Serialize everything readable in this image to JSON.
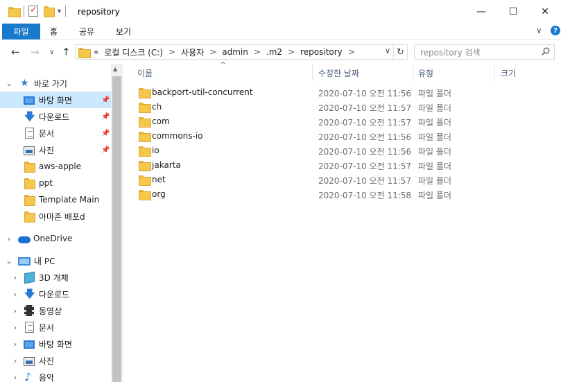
{
  "window": {
    "title": "repository",
    "minimize_glyph": "—",
    "maximize_glyph": "☐",
    "close_glyph": "✕"
  },
  "ribbon": {
    "tabs": [
      "파일",
      "홈",
      "공유",
      "보기"
    ],
    "expand_glyph": "∨",
    "help_glyph": "?"
  },
  "nav": {
    "back_glyph": "←",
    "forward_glyph": "→",
    "recent_glyph": "∨",
    "up_glyph": "↑"
  },
  "address": {
    "overflow": "«",
    "crumbs": [
      "로컬 디스크 (C:)",
      "사용자",
      "admin",
      ".m2",
      "repository"
    ],
    "separator": ">",
    "dropdown_glyph": "∨",
    "refresh_glyph": "↻"
  },
  "search": {
    "placeholder": "repository 검색"
  },
  "sidebar": {
    "quick_access": {
      "label": "바로 가기",
      "icon": "star-icon"
    },
    "pinned": [
      {
        "label": "바탕 화면",
        "icon": "desktop-icon",
        "pinned": true
      },
      {
        "label": "다운로드",
        "icon": "download-icon",
        "pinned": true
      },
      {
        "label": "문서",
        "icon": "document-icon",
        "pinned": true
      },
      {
        "label": "사진",
        "icon": "picture-icon",
        "pinned": true
      }
    ],
    "recent": [
      {
        "label": "aws-apple",
        "icon": "folder-icon"
      },
      {
        "label": "ppt",
        "icon": "folder-icon"
      },
      {
        "label": "Template Main",
        "icon": "folder-icon"
      },
      {
        "label": "아마존 배포d",
        "icon": "folder-icon"
      }
    ],
    "onedrive": {
      "label": "OneDrive",
      "icon": "cloud-icon"
    },
    "this_pc": {
      "label": "내 PC",
      "icon": "computer-icon"
    },
    "pc_items": [
      {
        "label": "3D 개체",
        "icon": "cube-icon"
      },
      {
        "label": "다운로드",
        "icon": "download-icon"
      },
      {
        "label": "동영상",
        "icon": "film-icon"
      },
      {
        "label": "문서",
        "icon": "document-icon"
      },
      {
        "label": "바탕 화면",
        "icon": "desktop-icon"
      },
      {
        "label": "사진",
        "icon": "picture-icon"
      },
      {
        "label": "음악",
        "icon": "music-icon"
      }
    ]
  },
  "columns": {
    "name": "이름",
    "date": "수정한 날짜",
    "type": "유형",
    "size": "크기"
  },
  "files": [
    {
      "name": "backport-util-concurrent",
      "date": "2020-07-10 오전 11:56",
      "type": "파일 폴더"
    },
    {
      "name": "ch",
      "date": "2020-07-10 오전 11:57",
      "type": "파일 폴더"
    },
    {
      "name": "com",
      "date": "2020-07-10 오전 11:57",
      "type": "파일 폴더"
    },
    {
      "name": "commons-io",
      "date": "2020-07-10 오전 11:56",
      "type": "파일 폴더"
    },
    {
      "name": "io",
      "date": "2020-07-10 오전 11:56",
      "type": "파일 폴더"
    },
    {
      "name": "jakarta",
      "date": "2020-07-10 오전 11:57",
      "type": "파일 폴더"
    },
    {
      "name": "net",
      "date": "2020-07-10 오전 11:57",
      "type": "파일 폴더"
    },
    {
      "name": "org",
      "date": "2020-07-10 오전 11:58",
      "type": "파일 폴더"
    }
  ],
  "colors": {
    "accent": "#1979ca",
    "selection": "#cce8ff",
    "folder": "#f5c84c"
  }
}
